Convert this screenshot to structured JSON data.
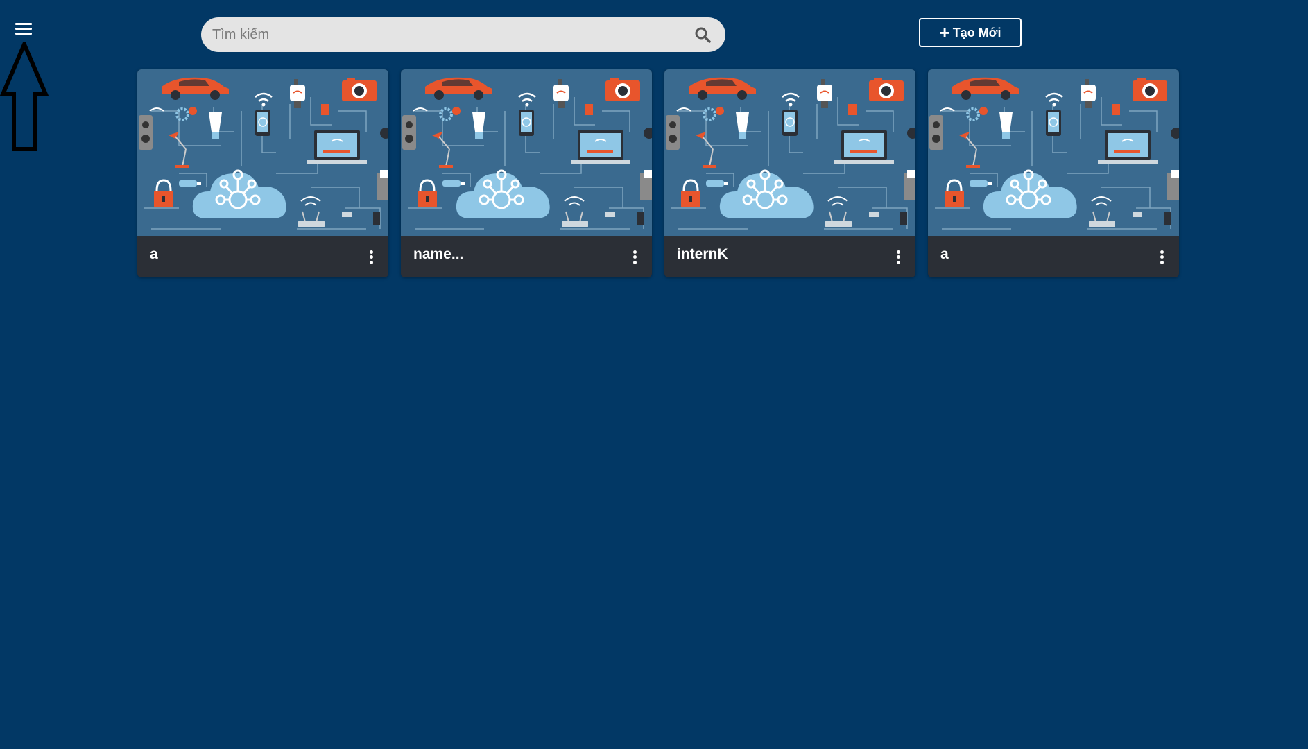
{
  "header": {
    "menu_icon": "hamburger-menu-icon",
    "search": {
      "placeholder": "Tìm kiếm",
      "value": "",
      "icon": "search-icon"
    },
    "create_button": {
      "icon": "plus-icon",
      "label": "Tạo Mới"
    }
  },
  "annotation": {
    "icon": "up-arrow-icon"
  },
  "cards": [
    {
      "title": "a",
      "image": "iot-cloud-illustration",
      "menu_icon": "more-vertical-icon"
    },
    {
      "title": "name...",
      "image": "iot-cloud-illustration",
      "menu_icon": "more-vertical-icon"
    },
    {
      "title": "internK",
      "image": "iot-cloud-illustration",
      "menu_icon": "more-vertical-icon"
    },
    {
      "title": "a",
      "image": "iot-cloud-illustration",
      "menu_icon": "more-vertical-icon"
    }
  ],
  "colors": {
    "background": "#023865",
    "card_footer": "#2b2f36",
    "illustration_bg": "#3a6a8f",
    "accent_orange": "#e8552c",
    "cloud": "#8fc7e6"
  }
}
